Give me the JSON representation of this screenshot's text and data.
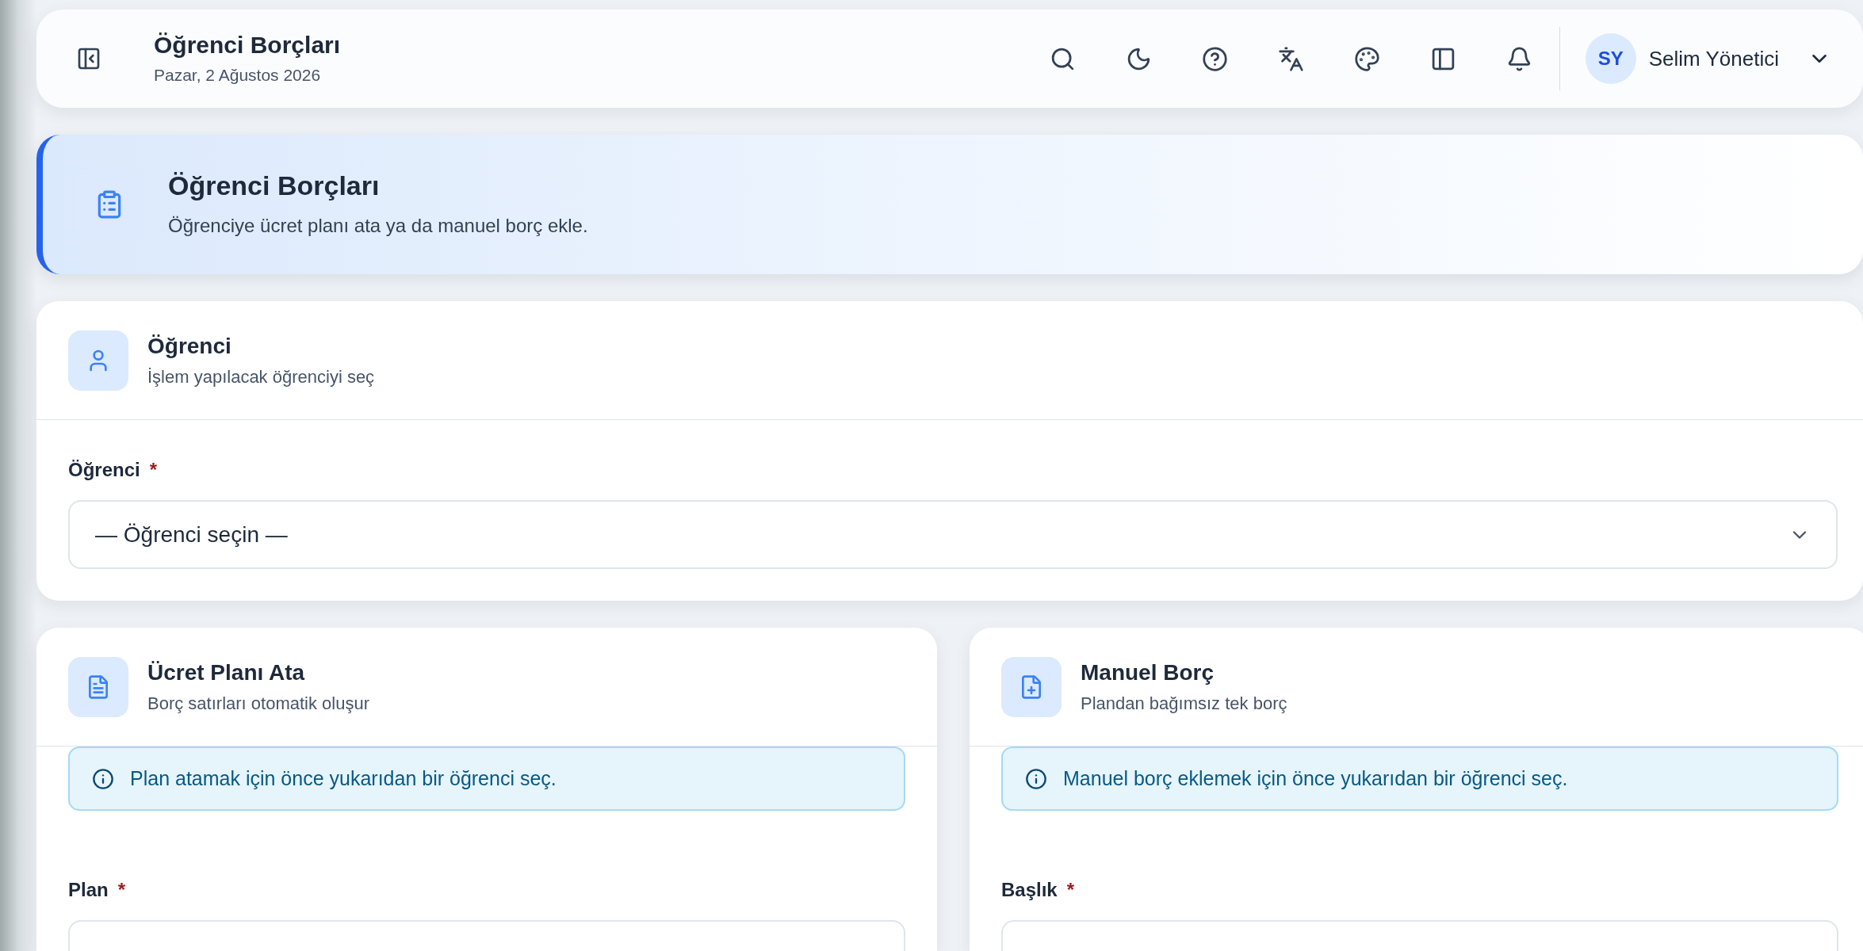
{
  "topbar": {
    "title": "Öğrenci Borçları",
    "date": "Pazar, 2 Ağustos 2026",
    "user": {
      "initials": "SY",
      "name": "Selim Yönetici"
    }
  },
  "hero": {
    "title": "Öğrenci Borçları",
    "subtitle": "Öğrenciye ücret planı ata ya da manuel borç ekle."
  },
  "student_card": {
    "title": "Öğrenci",
    "subtitle": "İşlem yapılacak öğrenciyi seç",
    "field": {
      "label": "Öğrenci",
      "required_mark": "*",
      "value": "— Öğrenci seçin —"
    }
  },
  "panels": [
    {
      "title": "Ücret Planı Ata",
      "subtitle": "Borç satırları otomatik oluşur",
      "notice": "Plan atamak için önce yukarıdan bir öğrenci seç.",
      "field": {
        "label": "Plan",
        "required_mark": "*"
      }
    },
    {
      "title": "Manuel Borç",
      "subtitle": "Plandan bağımsız tek borç",
      "notice": "Manuel borç eklemek için önce yukarıdan bir öğrenci seç.",
      "field": {
        "label": "Başlık",
        "required_mark": "*"
      }
    }
  ]
}
